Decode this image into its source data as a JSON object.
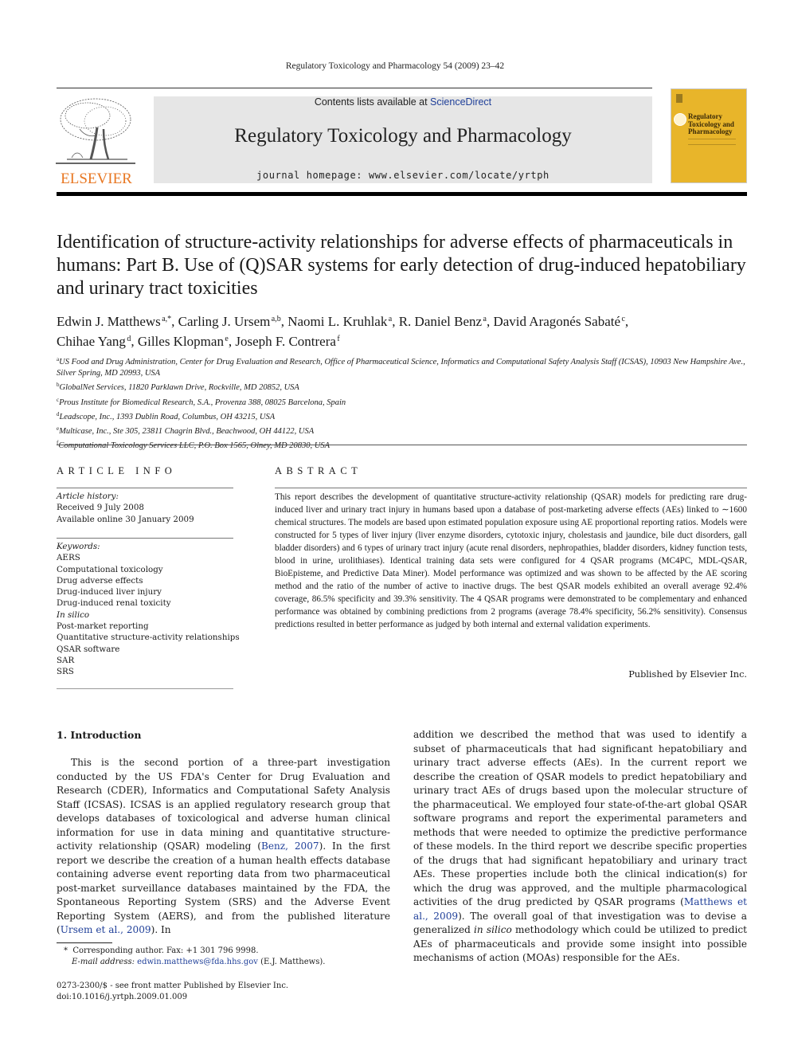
{
  "journal": {
    "running_head": "Regulatory Toxicology and Pharmacology 54 (2009) 23–42",
    "contents_prefix": "Contents lists available at ",
    "contents_link": "ScienceDirect",
    "title": "Regulatory Toxicology and Pharmacology",
    "homepage": "journal homepage: www.elsevier.com/locate/yrtph",
    "publisher_logo": "ELSEVIER",
    "cover_title_lines": [
      "Regulatory",
      "Toxicology and",
      "Pharmacology"
    ],
    "colors": {
      "publisher_orange": "#e87722",
      "cover_yellow": "#e8b52a",
      "link_blue": "#1f3f99",
      "banner_gray": "#e6e6e6"
    }
  },
  "article": {
    "title": "Identification of structure-activity relationships for adverse effects of pharmaceuticals in humans: Part B. Use of (Q)SAR systems for early detection of drug-induced hepatobiliary and urinary tract toxicities",
    "authors": [
      {
        "name": "Edwin J. Matthews",
        "aff": "a,*"
      },
      {
        "name": "Carling J. Ursem",
        "aff": "a,b"
      },
      {
        "name": "Naomi L. Kruhlak",
        "aff": "a"
      },
      {
        "name": "R. Daniel Benz",
        "aff": "a"
      },
      {
        "name": "David Aragonés Sabaté",
        "aff": "c"
      },
      {
        "name": "Chihae Yang",
        "aff": "d"
      },
      {
        "name": "Gilles Klopman",
        "aff": "e"
      },
      {
        "name": "Joseph F. Contrera",
        "aff": "f"
      }
    ],
    "affiliations": [
      {
        "key": "a",
        "text": "US Food and Drug Administration, Center for Drug Evaluation and Research, Office of Pharmaceutical Science, Informatics and Computational Safety Analysis Staff (ICSAS), 10903 New Hampshire Ave., Silver Spring, MD 20993, USA"
      },
      {
        "key": "b",
        "text": "GlobalNet Services, 11820 Parklawn Drive, Rockville, MD 20852, USA"
      },
      {
        "key": "c",
        "text": "Prous Institute for Biomedical Research, S.A., Provenza 388, 08025 Barcelona, Spain"
      },
      {
        "key": "d",
        "text": "Leadscope, Inc., 1393 Dublin Road, Columbus, OH 43215, USA"
      },
      {
        "key": "e",
        "text": "Multicase, Inc., Ste 305, 23811 Chagrin Blvd., Beachwood, OH 44122, USA"
      },
      {
        "key": "f",
        "text": "Computational Toxicology Services LLC, P.O. Box 1565, Olney, MD 20830, USA"
      }
    ]
  },
  "article_info": {
    "label": "ARTICLE INFO",
    "history_label": "Article history:",
    "received": "Received 9 July 2008",
    "available": "Available online 30 January 2009",
    "keywords_label": "Keywords:",
    "keywords": [
      "AERS",
      "Computational toxicology",
      "Drug adverse effects",
      "Drug-induced liver injury",
      "Drug-induced renal toxicity",
      "In silico",
      "Post-market reporting",
      "Quantitative structure-activity relationships",
      "QSAR software",
      "SAR",
      "SRS"
    ]
  },
  "abstract": {
    "label": "ABSTRACT",
    "text": "This report describes the development of quantitative structure-activity relationship (QSAR) models for predicting rare drug-induced liver and urinary tract injury in humans based upon a database of post-marketing adverse effects (AEs) linked to ∼1600 chemical structures. The models are based upon estimated population exposure using AE proportional reporting ratios. Models were constructed for 5 types of liver injury (liver enzyme disorders, cytotoxic injury, cholestasis and jaundice, bile duct disorders, gall bladder disorders) and 6 types of urinary tract injury (acute renal disorders, nephropathies, bladder disorders, kidney function tests, blood in urine, urolithiases). Identical training data sets were configured for 4 QSAR programs (MC4PC, MDL-QSAR, BioEpisteme, and Predictive Data Miner). Model performance was optimized and was shown to be affected by the AE scoring method and the ratio of the number of active to inactive drugs. The best QSAR models exhibited an overall average 92.4% coverage, 86.5% specificity and 39.3% sensitivity. The 4 QSAR programs were demonstrated to be complementary and enhanced performance was obtained by combining predictions from 2 programs (average 78.4% specificity, 56.2% sensitivity). Consensus predictions resulted in better performance as judged by both internal and external validation experiments.",
    "published_by": "Published by Elsevier Inc."
  },
  "intro": {
    "heading": "1. Introduction",
    "col1": {
      "p1": "This is the second portion of a three-part investigation conducted by the US FDA's Center for Drug Evaluation and Research (CDER), Informatics and Computational Safety Analysis Staff (ICSAS). ICSAS is an applied regulatory research group that develops databases of toxicological and adverse human clinical information for use in data mining and quantitative structure-activity relationship (QSAR) modeling (",
      "ref1": "Benz, 2007",
      "p2": "). In the first report we describe the creation of a human health effects database containing adverse event reporting data from two pharmaceutical post-market surveillance databases maintained by the FDA, the Spontaneous Reporting System (SRS) and the Adverse Event Reporting System (AERS), and from the published literature (",
      "ref2": "Ursem et al., 2009",
      "p3": "). In"
    },
    "col2": {
      "p1": "addition we described the method that was used to identify a subset of pharmaceuticals that had significant hepatobiliary and urinary tract adverse effects (AEs). In the current report we describe the creation of QSAR models to predict hepatobiliary and urinary tract AEs of drugs based upon the molecular structure of the pharmaceutical. We employed four state-of-the-art global QSAR software programs and report the experimental parameters and methods that were needed to optimize the predictive performance of these models. In the third report we describe specific properties of the drugs that had significant hepatobiliary and urinary tract AEs. These properties include both the clinical indication(s) for which the drug was approved, and the multiple pharmacological activities of the drug predicted by QSAR programs (",
      "ref1": "Matthews et al., 2009",
      "p2": "). The overall goal of that investigation was to devise a generalized ",
      "italic": "in silico",
      "p3": " methodology which could be utilized to predict AEs of pharmaceuticals and provide some insight into possible mechanisms of action (MOAs) responsible for the AEs."
    }
  },
  "footnotes": {
    "star": "*",
    "corresponding": "Corresponding author. Fax: +1 301 796 9998.",
    "email_label": "E-mail address:",
    "email": "edwin.matthews@fda.hhs.gov",
    "email_suffix": " (E.J. Matthews).",
    "issn": "0273-2300/$ - see front matter Published by Elsevier Inc.",
    "doi": "doi:10.1016/j.yrtph.2009.01.009"
  }
}
